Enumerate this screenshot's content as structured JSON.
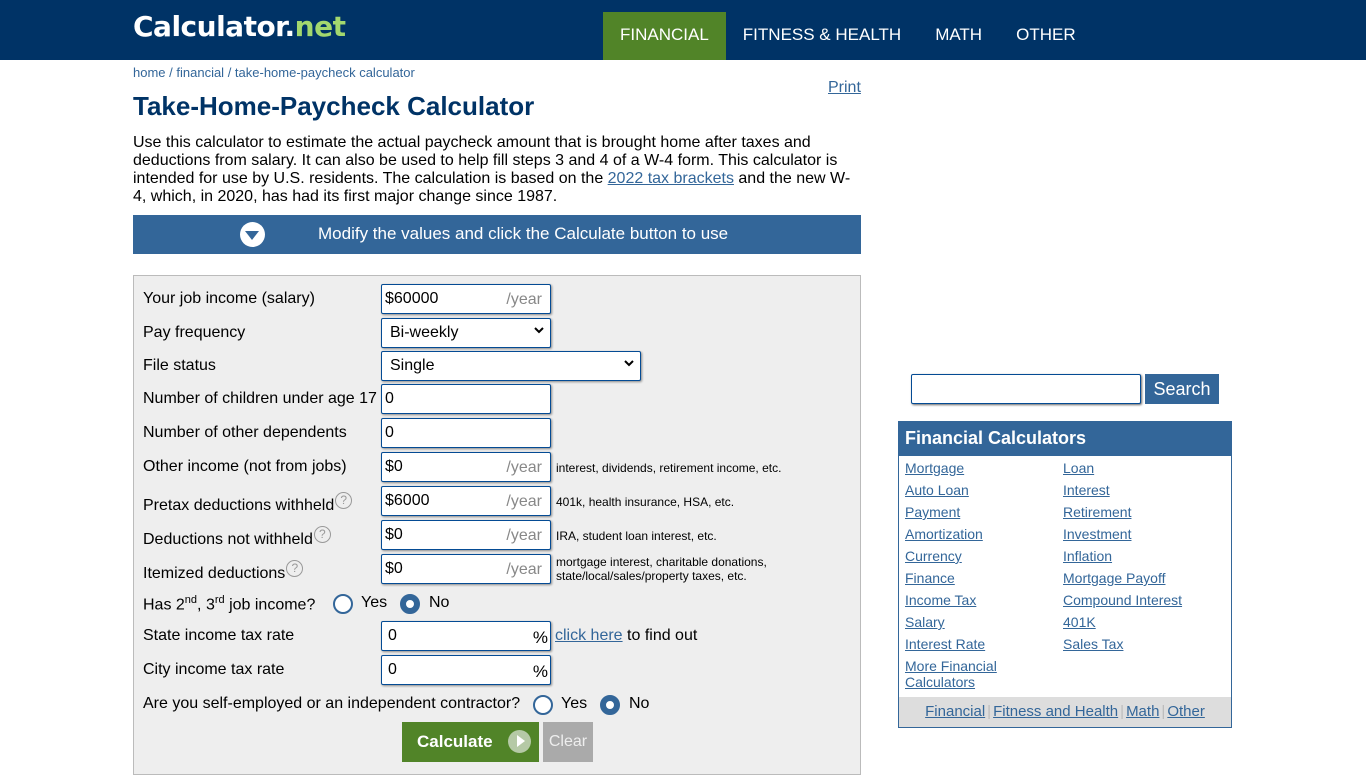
{
  "header": {
    "logo_main": "Calculator.",
    "logo_tld": "net",
    "nav": [
      {
        "label": "FINANCIAL",
        "active": true
      },
      {
        "label": "FITNESS & HEALTH",
        "active": false
      },
      {
        "label": "MATH",
        "active": false
      },
      {
        "label": "OTHER",
        "active": false
      }
    ]
  },
  "breadcrumb": {
    "items": [
      "home",
      "financial",
      "take-home-paycheck calculator"
    ],
    "separator": " / "
  },
  "print_label": "Print",
  "page_title": "Take-Home-Paycheck Calculator",
  "intro": {
    "text_before_link": "Use this calculator to estimate the actual paycheck amount that is brought home after taxes and deductions from salary. It can also be used to help fill steps 3 and 4 of a W-4 form. This calculator is intended for use by U.S. residents. The calculation is based on the ",
    "link_text": "2022 tax brackets",
    "text_after_link": " and the new W-4, which, in 2020, has had its first major change since 1987."
  },
  "modify_bar": {
    "text": "Modify the values and click the Calculate button to use",
    "icon": "chevron-down-circle-icon"
  },
  "form": {
    "job_income": {
      "label": "Your job income (salary)",
      "value": "$60000",
      "unit": "/year"
    },
    "pay_frequency": {
      "label": "Pay frequency",
      "value": "Bi-weekly"
    },
    "file_status": {
      "label": "File status",
      "value": "Single"
    },
    "children": {
      "label": "Number of children under age 17",
      "value": "0"
    },
    "other_dependents": {
      "label": "Number of other dependents",
      "value": "0"
    },
    "other_income": {
      "label": "Other income (not from jobs)",
      "value": "$0",
      "unit": "/year",
      "hint": "interest, dividends, retirement income, etc."
    },
    "pretax_deductions": {
      "label": "Pretax deductions withheld",
      "value": "$6000",
      "unit": "/year",
      "hint": "401k, health insurance, HSA, etc."
    },
    "deductions_not_withheld": {
      "label": "Deductions not withheld",
      "value": "$0",
      "unit": "/year",
      "hint": "IRA, student loan interest, etc."
    },
    "itemized_deductions": {
      "label": "Itemized deductions",
      "value": "$0",
      "unit": "/year",
      "hint_line1": "mortgage interest, charitable donations,",
      "hint_line2": "state/local/sales/property taxes, etc."
    },
    "second_job": {
      "label_pre": "Has 2",
      "sup1": "nd",
      "label_mid": ", 3",
      "sup2": "rd",
      "label_post": " job income?",
      "options": [
        "Yes",
        "No"
      ],
      "selected": "No"
    },
    "state_tax": {
      "label": "State income tax rate",
      "value": "0",
      "unit": "%",
      "link_text": "click here",
      "link_after": " to find out"
    },
    "city_tax": {
      "label": "City income tax rate",
      "value": "0",
      "unit": "%"
    },
    "self_employed": {
      "label": "Are you self-employed or an independent contractor?",
      "options": [
        "Yes",
        "No"
      ],
      "selected": "No"
    },
    "help_glyph": "?",
    "calculate_label": "Calculate",
    "clear_label": "Clear"
  },
  "sidebar": {
    "search_value": "",
    "search_button": "Search",
    "fin_title": "Financial Calculators",
    "links_left": [
      "Mortgage",
      "Auto Loan",
      "Payment",
      "Amortization",
      "Currency",
      "Finance",
      "Income Tax",
      "Salary",
      "Interest Rate",
      "More Financial",
      "Calculators"
    ],
    "links_right": [
      "Loan",
      "Interest",
      "Retirement",
      "Investment",
      "Inflation",
      "Mortgage Payoff",
      "Compound Interest",
      "401K",
      "Sales Tax"
    ],
    "footer_links": [
      "Financial",
      "Fitness and Health",
      "Math",
      "Other"
    ],
    "footer_sep": "|"
  }
}
